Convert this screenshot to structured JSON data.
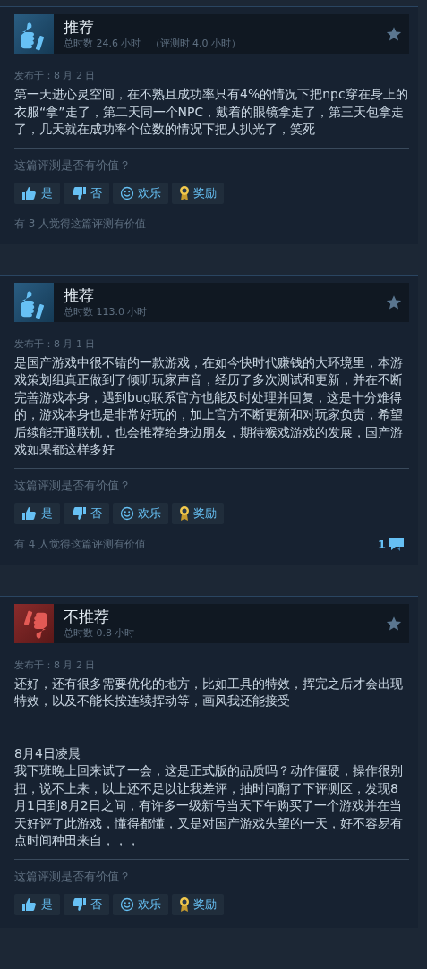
{
  "reviews": [
    {
      "recommended": true,
      "verdict": "推荐",
      "playtime": "总时数 24.6 小时",
      "playtime_at_review": "（评测时 4.0 小时）",
      "posted": "发布于：8 月 2 日",
      "body": "第一天进心灵空间，在不熟且成功率只有4%的情况下把npc穿在身上的衣服“拿”走了，第二天同一个NPC，戴着的眼镜拿走了，第三天包拿走了，几天就在成功率个位数的情况下把人扒光了，笑死",
      "helpful_question": "这篇评测是否有价值？",
      "buttons": [
        {
          "kind": "yes",
          "label": "是"
        },
        {
          "kind": "no",
          "label": "否"
        },
        {
          "kind": "funny",
          "label": "欢乐"
        },
        {
          "kind": "award",
          "label": "奖励"
        }
      ],
      "helpful_count": "有 3 人觉得这篇评测有价值"
    },
    {
      "recommended": true,
      "verdict": "推荐",
      "playtime": "总时数 113.0 小时",
      "posted": "发布于：8 月 1 日",
      "body": "是国产游戏中很不错的一款游戏，在如今快时代赚钱的大环境里，本游戏策划组真正做到了倾听玩家声音，经历了多次测试和更新，并在不断完善游戏本身，遇到bug联系官方也能及时处理并回复，这是十分难得的，游戏本身也是非常好玩的，加上官方不断更新和对玩家负责，希望后续能开通联机，也会推荐给身边朋友，期待猴戏游戏的发展，国产游戏如果都这样多好",
      "helpful_question": "这篇评测是否有价值？",
      "buttons": [
        {
          "kind": "yes",
          "label": "是"
        },
        {
          "kind": "no",
          "label": "否"
        },
        {
          "kind": "funny",
          "label": "欢乐"
        },
        {
          "kind": "award",
          "label": "奖励"
        }
      ],
      "helpful_count": "有 4 人觉得这篇评测有价值",
      "comment_count": "1"
    },
    {
      "recommended": false,
      "verdict": "不推荐",
      "playtime": "总时数 0.8 小时",
      "posted": "发布于：8 月 2 日",
      "body": "还好，还有很多需要优化的地方，比如工具的特效，挥完之后才会出现特效，以及不能长按连续挥动等，画风我还能接受",
      "update": {
        "title": "8月4日凌晨",
        "text": "我下班晚上回来试了一会，这是正式版的品质吗？动作僵硬，操作很别扭，说不上来，以上还不足以让我差评，抽时间翻了下评测区，发现8月1日到8月2日之间，有许多一级新号当天下午购买了一个游戏并在当天好评了此游戏，懂得都懂，又是对国产游戏失望的一天，好不容易有点时间种田来自，，，"
      },
      "helpful_question": "这篇评测是否有价值？",
      "buttons": [
        {
          "kind": "yes",
          "label": "是"
        },
        {
          "kind": "no",
          "label": "否"
        },
        {
          "kind": "funny",
          "label": "欢乐"
        },
        {
          "kind": "award",
          "label": "奖励"
        }
      ]
    }
  ]
}
